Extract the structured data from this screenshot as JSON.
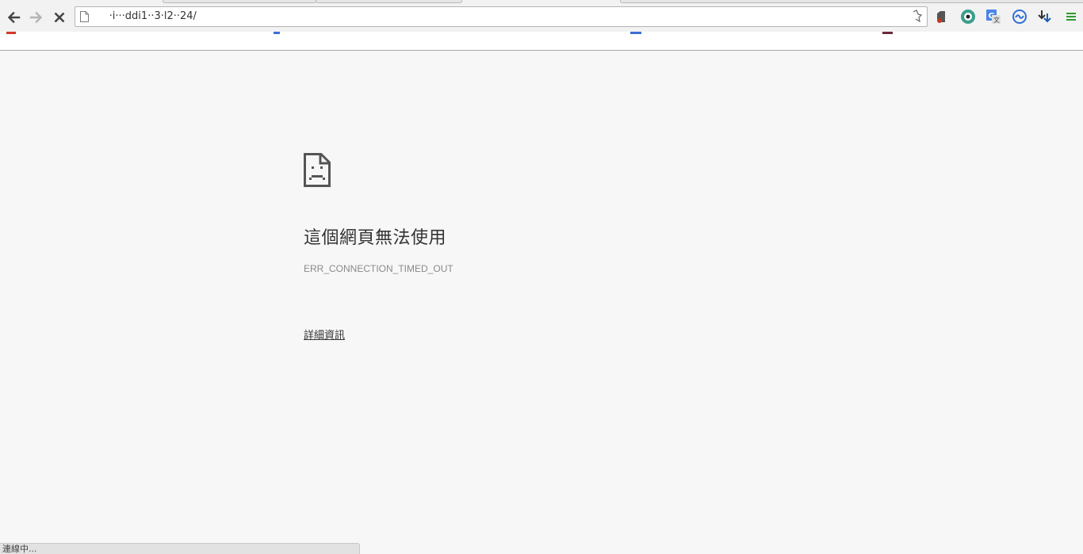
{
  "browser": {
    "url": "     ·i···ddi1··3·l2··24/",
    "status_text": "連線中..."
  },
  "toolbar": {
    "back_icon": "arrow-left-icon",
    "forward_icon": "arrow-right-icon",
    "stop_icon": "close-icon",
    "menu_icon": "hamburger-menu-icon"
  },
  "extensions": [
    {
      "name": "evernote-extension-icon"
    },
    {
      "name": "camera-extension-icon"
    },
    {
      "name": "google-translate-extension-icon"
    },
    {
      "name": "sync-extension-icon"
    },
    {
      "name": "download-extension-icon"
    }
  ],
  "error": {
    "title": "這個網頁無法使用",
    "code": "ERR_CONNECTION_TIMED_OUT",
    "details_link": "詳細資訊"
  },
  "colors": {
    "page_bg": "#f7f7f7",
    "title_text": "#333333",
    "code_text": "#8a8a8a"
  }
}
